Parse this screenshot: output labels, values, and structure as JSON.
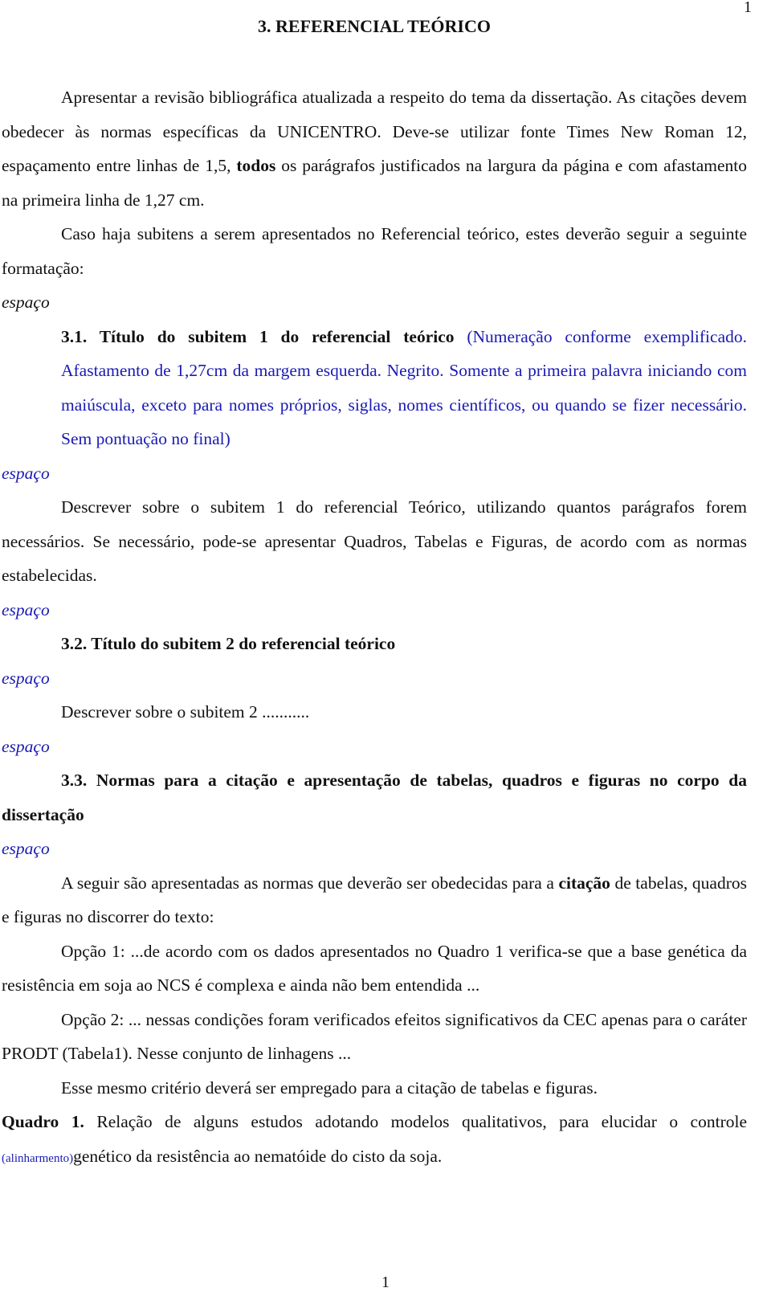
{
  "page_number_top": "1",
  "page_number_bottom": "1",
  "title": "3. REFERENCIAL TEÓRICO",
  "intro": {
    "part1": "Apresentar a revisão bibliográfica atualizada a respeito do tema da dissertação. As citações devem obedecer às normas específicas da UNICENTRO. Deve-se utilizar fonte Times New Roman 12, espaçamento entre linhas de 1,5, ",
    "bold": "todos",
    "part2": " os parágrafos justificados na largura da página e com afastamento na primeira linha de 1,27 cm."
  },
  "subitems_intro": "Caso haja subitens a serem apresentados no Referencial teórico, estes deverão seguir a seguinte formatação:",
  "spacer_label": "espaço",
  "section_3_1": {
    "heading": "3.1. Título do subitem 1 do referencial teórico",
    "note": " (Numeração conforme exemplificado. Afastamento de 1,27cm da margem esquerda. Negrito. Somente a primeira palavra iniciando com maiúscula, exceto para nomes próprios, siglas, nomes científicos, ou quando se fizer necessário. Sem pontuação no final)",
    "body": "Descrever sobre o subitem 1 do referencial Teórico, utilizando quantos parágrafos forem necessários. Se necessário, pode-se apresentar Quadros, Tabelas e Figuras, de acordo com as normas estabelecidas."
  },
  "section_3_2": {
    "heading": "3.2. Título do subitem 2 do referencial teórico",
    "body": "Descrever sobre o subitem 2 ..........."
  },
  "section_3_3": {
    "heading": "3.3. Normas para a citação e apresentação de tabelas, quadros e figuras no corpo da dissertação",
    "body_part1": "A seguir são apresentadas as normas que deverão ser obedecidas para a ",
    "body_bold": "citação",
    "body_part2": " de tabelas, quadros e figuras no discorrer do texto:",
    "option1": "Opção 1: ...de acordo com os dados apresentados no Quadro 1 verifica-se que a base genética da resistência em soja ao NCS é complexa e ainda não bem entendida ...",
    "option2": "Opção 2: ... nessas condições foram verificados efeitos significativos da CEC apenas para o caráter PRODT (Tabela1). Nesse conjunto de linhagens ...",
    "criteria": "Esse mesmo critério deverá ser empregado para a citação de tabelas e figuras."
  },
  "quadro": {
    "label": "Quadro 1.",
    "caption_part1": " Relação de alguns estudos adotando modelos qualitativos, para elucidar o controle ",
    "alignment_note": "(alinharmento)",
    "caption_part2": "genético da resistência ao nematóide do cisto da soja."
  },
  "colors": {
    "text": "#111111",
    "annotation_blue": "#1a1ab4"
  }
}
